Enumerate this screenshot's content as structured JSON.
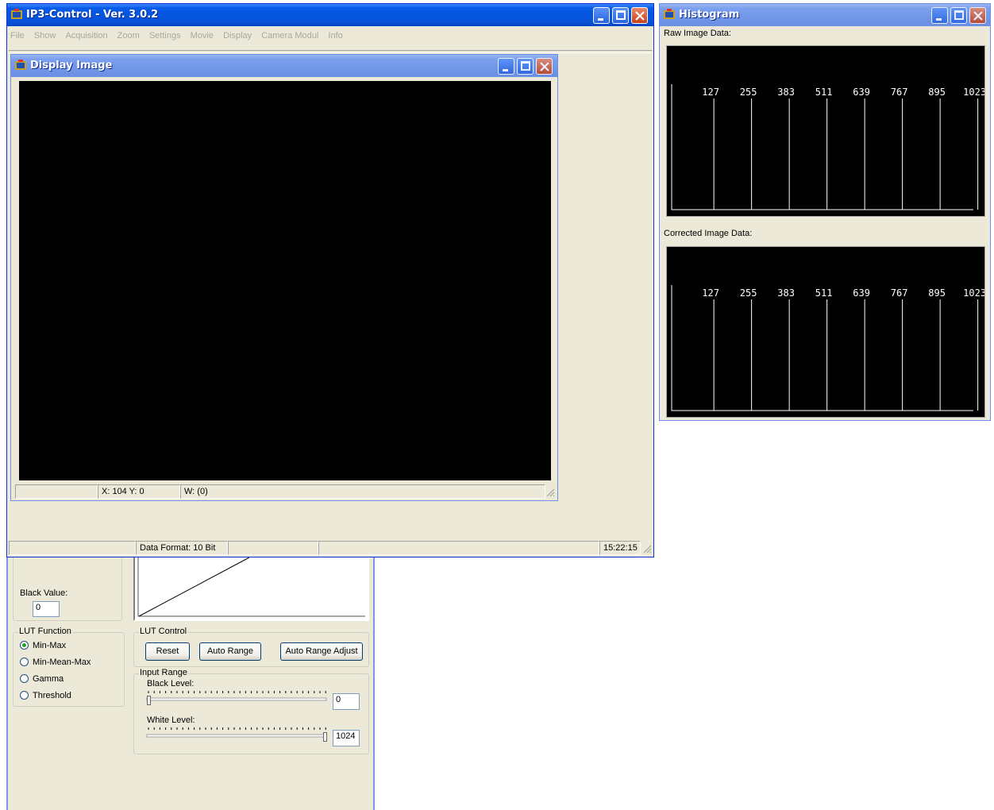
{
  "main_window": {
    "title": "IP3-Control - Ver. 3.0.2",
    "menu": [
      "File",
      "Show",
      "Acquisition",
      "Zoom",
      "Settings",
      "Movie",
      "Display",
      "Camera Modul",
      "Info"
    ],
    "status": {
      "data_format": "Data Format: 10 Bit",
      "time": "15:22:15"
    }
  },
  "display_window": {
    "title": "Display Image",
    "status": {
      "coords": "X: 104  Y: 0",
      "value": "W: (0)"
    }
  },
  "histogram_window": {
    "title": "Histogram",
    "raw_label": "Raw Image Data:",
    "corrected_label": "Corrected Image Data:",
    "tick_labels": [
      "127",
      "255",
      "383",
      "511",
      "639",
      "767",
      "895",
      "1023"
    ]
  },
  "lut_panel": {
    "black_value_label": "Black Value:",
    "black_value": "0",
    "lut_function": {
      "legend": "LUT Function",
      "options": [
        "Min-Max",
        "Min-Mean-Max",
        "Gamma",
        "Threshold"
      ],
      "selected": "Min-Max"
    },
    "lut_control": {
      "legend": "LUT Control",
      "reset": "Reset",
      "auto_range": "Auto Range",
      "auto_range_adjust": "Auto Range Adjust"
    },
    "input_range": {
      "legend": "Input Range",
      "black_level_label": "Black Level:",
      "black_level_value": "0",
      "black_level_fraction": 0.0,
      "white_level_label": "White Level:",
      "white_level_value": "1024",
      "white_level_fraction": 1.0
    }
  },
  "colors": {
    "title_active": "#0355e0",
    "window_face": "#ece9d8",
    "display_bg": "#000000",
    "histogram_bg": "#000000",
    "histogram_line": "#ffffff"
  }
}
